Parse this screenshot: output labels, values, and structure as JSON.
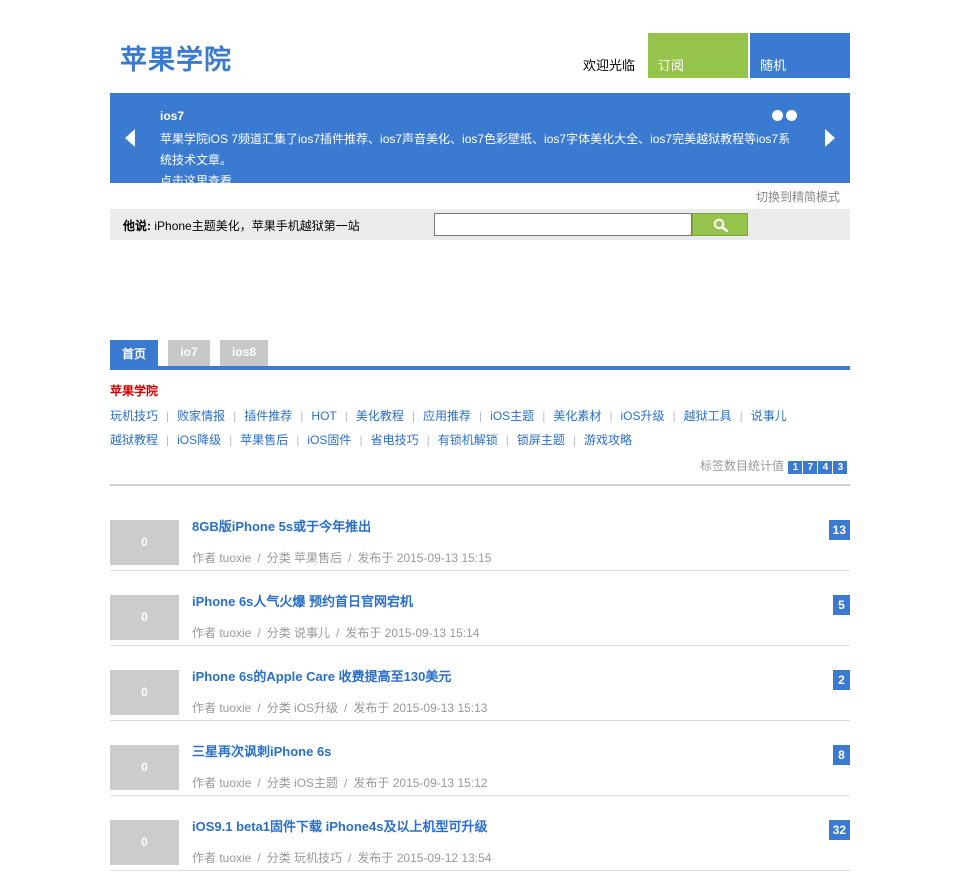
{
  "header": {
    "logo": "苹果学院",
    "welcome": "欢迎光临",
    "subscribe": "订阅",
    "random": "随机"
  },
  "banner": {
    "title": "ios7",
    "desc": "苹果学院iOS 7频道汇集了ios7插件推荐、ios7声音美化、ios7色彩壁纸、ios7字体美化大全、ios7完美越狱教程等ios7系统技术文章。",
    "more": "点击这里查看",
    "slides": 2
  },
  "switch_mode": "切换到精简模式 ˄",
  "searchbar": {
    "say_label": "他说:",
    "say_text": "iPhone主题美化，苹果手机越狱第一站",
    "input_value": "",
    "button_icon": "search-icon"
  },
  "tabs": [
    "首页",
    "io7",
    "ios8"
  ],
  "category": {
    "title": "苹果学院",
    "row1": [
      "玩机技巧",
      "败家情报",
      "插件推荐",
      "HOT",
      "美化教程",
      "应用推荐",
      "iOS主题",
      "美化素材",
      "iOS升级",
      "越狱工具",
      "说事儿"
    ],
    "row2": [
      "越狱教程",
      "iOS降级",
      "苹果售后",
      "iOS固件",
      "省电技巧",
      "有锁机解锁",
      "锁屏主题",
      "游戏攻略"
    ]
  },
  "stat": {
    "label": "标签数目统计值",
    "digits": [
      "1",
      "7",
      "4",
      "3"
    ]
  },
  "posts": [
    {
      "thumb": "0",
      "title": "8GB版iPhone 5s或于今年推出",
      "author": "作者 tuoxie",
      "category": "分类 苹果售后",
      "date": "发布于 2015-09-13 15:15",
      "count": "13"
    },
    {
      "thumb": "0",
      "title": "iPhone 6s人气火爆 预约首日官网宕机",
      "author": "作者 tuoxie",
      "category": "分类 说事儿",
      "date": "发布于 2015-09-13 15:14",
      "count": "5"
    },
    {
      "thumb": "0",
      "title": "iPhone 6s的Apple Care 收费提高至130美元",
      "author": "作者 tuoxie",
      "category": "分类 iOS升级",
      "date": "发布于 2015-09-13 15:13",
      "count": "2"
    },
    {
      "thumb": "0",
      "title": "三星再次讽刺iPhone 6s",
      "author": "作者 tuoxie",
      "category": "分类 iOS主题",
      "date": "发布于 2015-09-13 15:12",
      "count": "8"
    },
    {
      "thumb": "0",
      "title": "iOS9.1 beta1固件下载 iPhone4s及以上机型可升级",
      "author": "作者 tuoxie",
      "category": "分类 玩机技巧",
      "date": "发布于 2015-09-12 13:54",
      "count": "32"
    }
  ]
}
